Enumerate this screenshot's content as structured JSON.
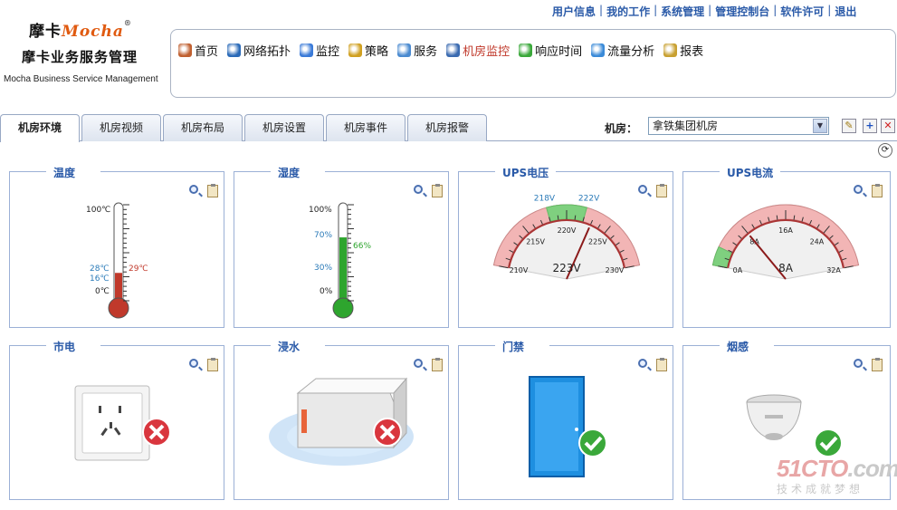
{
  "brand": {
    "logo_cn": "摩卡",
    "logo_en": "Mocha",
    "reg": "®",
    "title_cn": "摩卡业务服务管理",
    "title_en": "Mocha Business Service Management"
  },
  "top_links": [
    "用户信息",
    "我的工作",
    "系统管理",
    "管理控制台",
    "软件许可",
    "退出"
  ],
  "top_sep": "|",
  "nav": [
    {
      "label": "首页",
      "icon": "home-icon"
    },
    {
      "label": "网络拓扑",
      "icon": "network-topology-icon"
    },
    {
      "label": "监控",
      "icon": "monitor-icon"
    },
    {
      "label": "策略",
      "icon": "policy-icon"
    },
    {
      "label": "服务",
      "icon": "service-icon"
    },
    {
      "label": "机房监控",
      "icon": "datacenter-monitor-icon",
      "active": true
    },
    {
      "label": "响应时间",
      "icon": "response-time-icon"
    },
    {
      "label": "流量分析",
      "icon": "traffic-analysis-icon"
    },
    {
      "label": "报表",
      "icon": "report-icon"
    }
  ],
  "tabs": [
    "机房环境",
    "机房视频",
    "机房布局",
    "机房设置",
    "机房事件",
    "机房报警"
  ],
  "active_tab": "机房环境",
  "room": {
    "label": "机房：",
    "value": "拿铁集团机房",
    "edit": "✎",
    "add": "+",
    "delete": "✕"
  },
  "refresh": "⟳",
  "panels": {
    "temp": {
      "title": "温度",
      "max": "100℃",
      "min": "0℃",
      "low": "16℃",
      "high": "28℃",
      "current": "29℃",
      "level": 0.29,
      "color": "#c0392b"
    },
    "humidity": {
      "title": "湿度",
      "max": "100%",
      "min": "0%",
      "low": "30%",
      "high": "70%",
      "current": "66%",
      "level": 0.66,
      "color": "#2ea52e"
    },
    "ups_v": {
      "title": "UPS电压",
      "ticks": [
        "210V",
        "215V",
        "220V",
        "225V",
        "230V"
      ],
      "range": [
        210,
        230
      ],
      "green_band": [
        218,
        222
      ],
      "green_labels": [
        "218V",
        "222V"
      ],
      "value": 223,
      "readout": "223V"
    },
    "ups_a": {
      "title": "UPS电流",
      "ticks": [
        "0A",
        "8A",
        "16A",
        "24A",
        "32A"
      ],
      "range": [
        0,
        32
      ],
      "green_band": [
        0,
        3
      ],
      "value": 8,
      "readout": "8A"
    },
    "power": {
      "title": "市电",
      "status": "alarm"
    },
    "water": {
      "title": "浸水",
      "status": "alarm"
    },
    "door": {
      "title": "门禁",
      "status": "ok"
    },
    "smoke": {
      "title": "烟感",
      "status": "ok"
    }
  },
  "watermark": {
    "line1a": "51CTO",
    ".com": ".com",
    "line2": "技术成就梦想"
  },
  "colors": {
    "accent": "#2a5aa8",
    "alarm": "#d9363e",
    "ok": "#3aa83a",
    "gauge_red": "#f2b5b5",
    "gauge_green": "#7fd07f"
  }
}
